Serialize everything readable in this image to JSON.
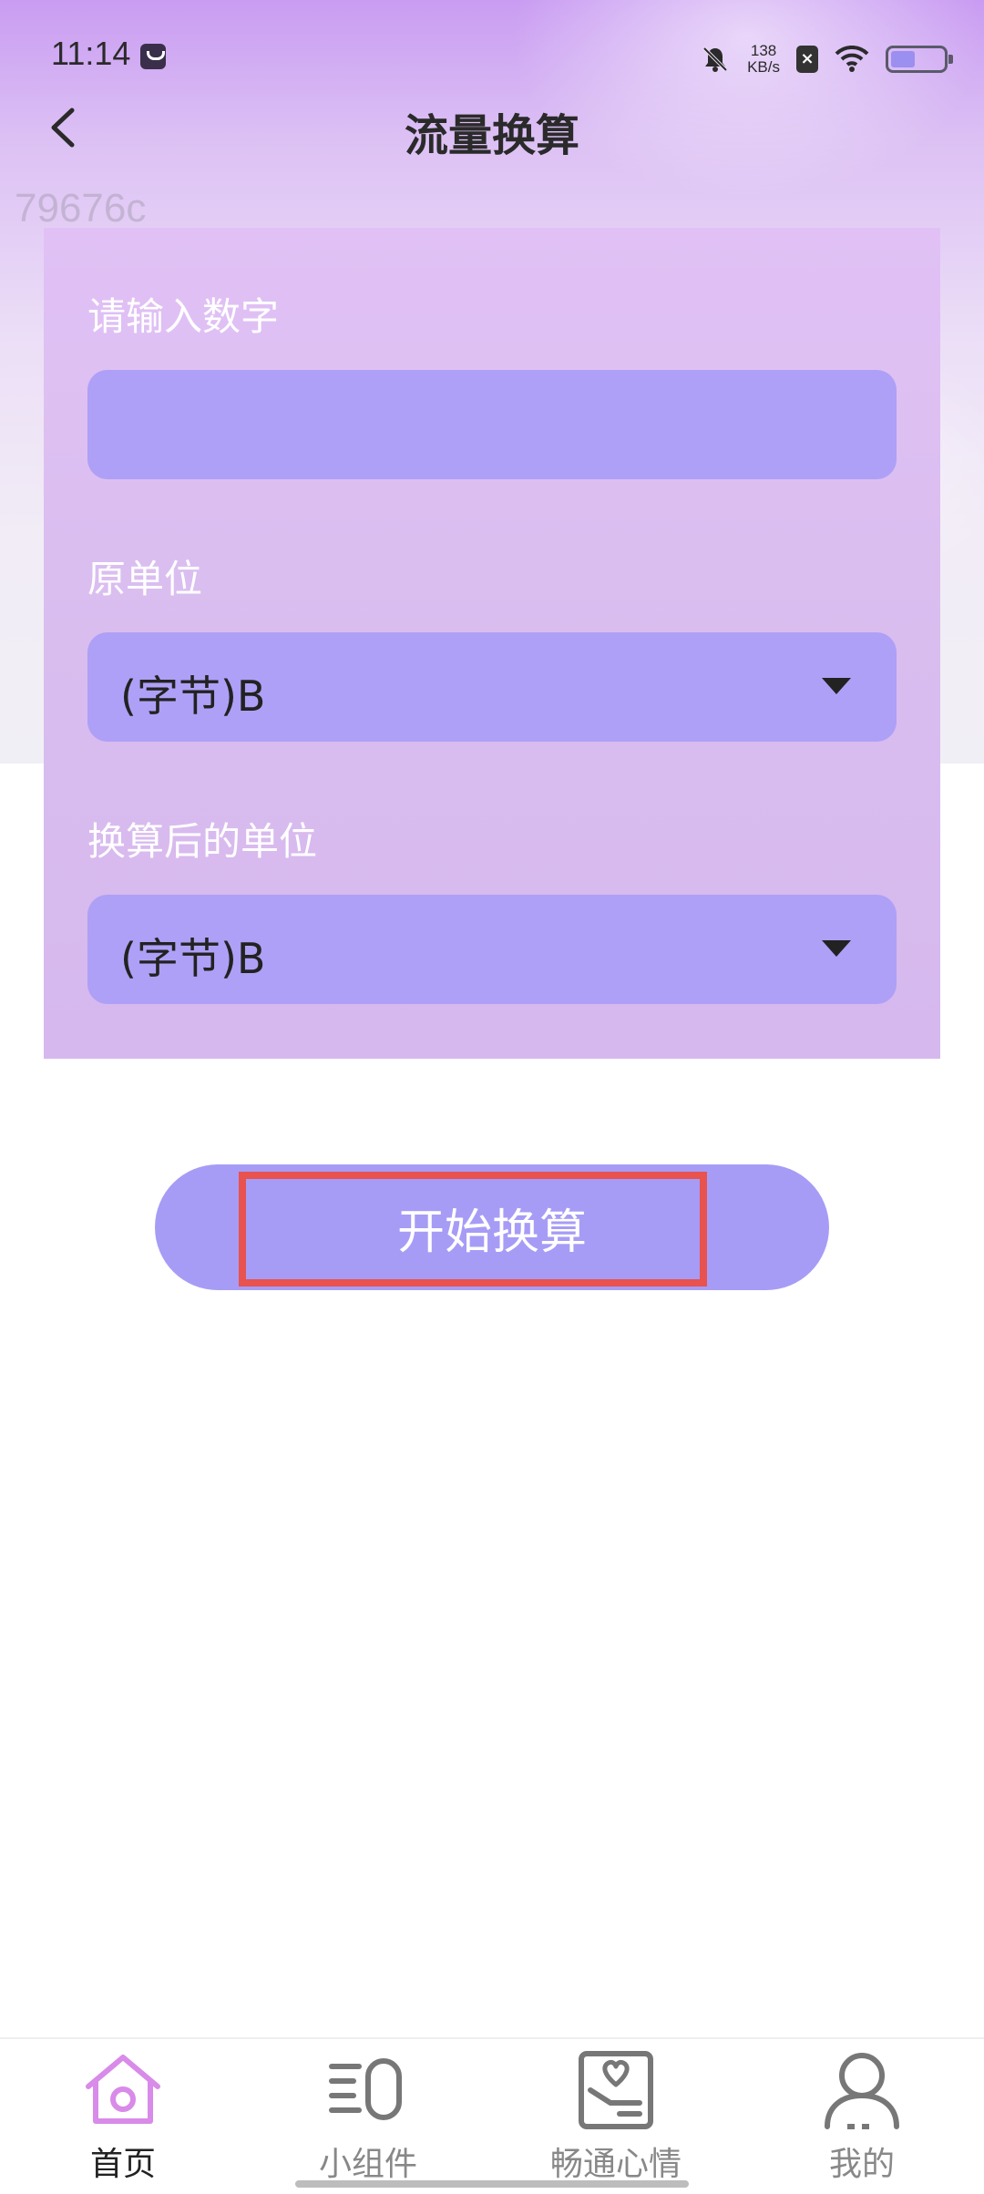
{
  "status_bar": {
    "time": "11:14",
    "net_speed_value": "138",
    "net_speed_unit": "KB/s"
  },
  "header": {
    "title": "流量换算"
  },
  "watermark": "79676c",
  "form": {
    "input_label": "请输入数字",
    "input_value": "",
    "source_unit_label": "原单位",
    "source_unit_value": "(字节)B",
    "target_unit_label": "换算后的单位",
    "target_unit_value": "(字节)B"
  },
  "convert_button_label": "开始换算",
  "bottom_nav": {
    "items": [
      {
        "label": "首页",
        "icon": "home-icon",
        "active": true
      },
      {
        "label": "小组件",
        "icon": "widget-icon",
        "active": false
      },
      {
        "label": "畅通心情",
        "icon": "mood-journal-icon",
        "active": false
      },
      {
        "label": "我的",
        "icon": "profile-icon",
        "active": false
      }
    ]
  },
  "colors": {
    "accent": "#a69cf6",
    "field_bg": "#aea0f6",
    "card_bg": "#dcbff2",
    "highlight": "#e8524f",
    "active_icon": "#d88be8"
  }
}
